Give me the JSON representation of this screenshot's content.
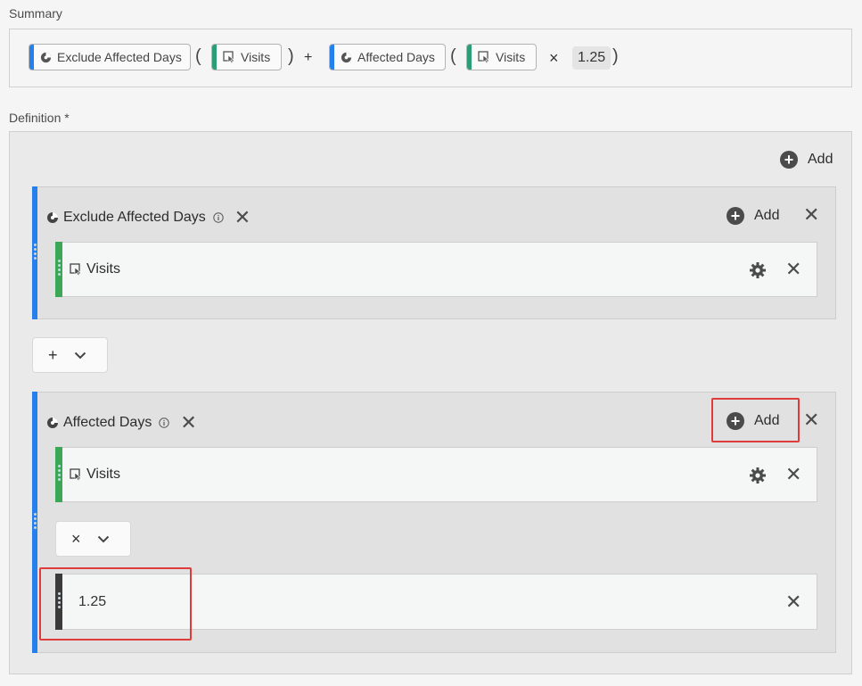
{
  "summary": {
    "label": "Summary",
    "exclude_chip": "Exclude Affected Days",
    "visits_chip_1": "Visits",
    "affected_chip": "Affected Days",
    "visits_chip_2": "Visits",
    "open_paren": "(",
    "close_paren": ")",
    "plus": "+",
    "times": "×",
    "number": "1.25"
  },
  "definition": {
    "label": "Definition *",
    "add_label": "Add",
    "container1": {
      "title": "Exclude Affected Days",
      "add_label": "Add",
      "metric": "Visits"
    },
    "operator1": "+",
    "container2": {
      "title": "Affected Days",
      "add_label": "Add",
      "metric": "Visits",
      "operator": "×",
      "static_number": "1.25"
    }
  },
  "colors": {
    "segment_blue": "#2680eb",
    "metric_green": "#3aa857",
    "highlight_red": "#e03b3b"
  },
  "icons": [
    "segment-icon",
    "metric-icon",
    "info-icon",
    "close-icon",
    "add-icon",
    "gear-icon",
    "chevron-down-icon",
    "drag-handle-icon"
  ]
}
